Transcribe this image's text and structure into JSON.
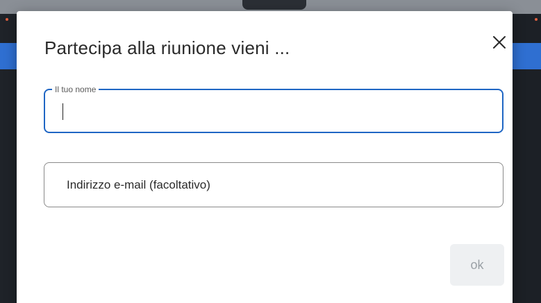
{
  "dialog": {
    "title": "Partecipa alla riunione vieni ...",
    "close_icon": "close-icon",
    "name_field": {
      "label": "Il tuo nome",
      "value": ""
    },
    "email_field": {
      "placeholder": "Indirizzo e-mail (facoltativo)",
      "value": ""
    },
    "ok_label": "ok"
  },
  "colors": {
    "focus_border": "#1f66c4",
    "ok_disabled_bg": "#eef0f2",
    "ok_disabled_text": "#9aa0a6",
    "background_accent": "#2f6fd1"
  }
}
